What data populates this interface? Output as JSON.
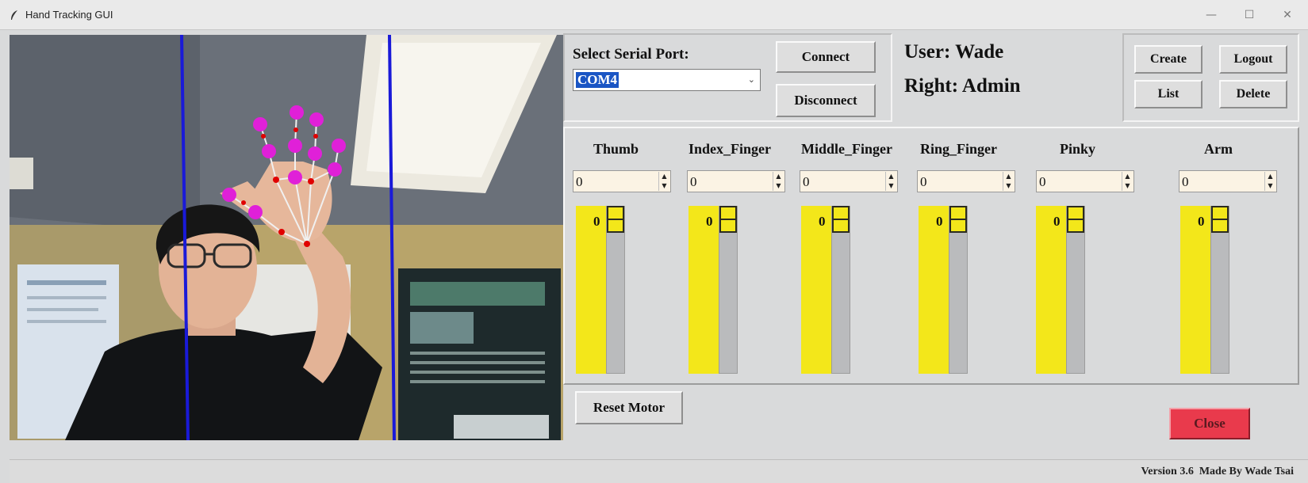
{
  "window": {
    "title": "Hand Tracking GUI",
    "controls": {
      "minimize": "—",
      "maximize": "☐",
      "close": "✕"
    }
  },
  "serial": {
    "label": "Select Serial Port:",
    "port": "COM4",
    "connect_label": "Connect",
    "disconnect_label": "Disconnect"
  },
  "user": {
    "user_text": "User: Wade",
    "right_text": "Right: Admin"
  },
  "account_buttons": {
    "create": "Create",
    "logout": "Logout",
    "list": "List",
    "delete": "Delete"
  },
  "motors": [
    {
      "name": "Thumb",
      "spin_value": "0",
      "slider_value": "0",
      "level": 0
    },
    {
      "name": "Index_Finger",
      "spin_value": "0",
      "slider_value": "0",
      "level": 0
    },
    {
      "name": "Middle_Finger",
      "spin_value": "0",
      "slider_value": "0",
      "level": 0
    },
    {
      "name": "Ring_Finger",
      "spin_value": "0",
      "slider_value": "0",
      "level": 0
    },
    {
      "name": "Pinky",
      "spin_value": "0",
      "slider_value": "0",
      "level": 0
    },
    {
      "name": "Arm",
      "spin_value": "0",
      "slider_value": "0",
      "level": 0
    }
  ],
  "actions": {
    "reset_motor": "Reset Motor",
    "close": "Close"
  },
  "status": {
    "version": "Version 3.6",
    "author": "Made By Wade Tsai"
  },
  "colors": {
    "slider_fill": "#f3e71a",
    "close_button": "#e93a4c",
    "hand_landmark": "#e020d8",
    "tracking_line": "#1a1ad8",
    "selection": "#1a55c4"
  }
}
